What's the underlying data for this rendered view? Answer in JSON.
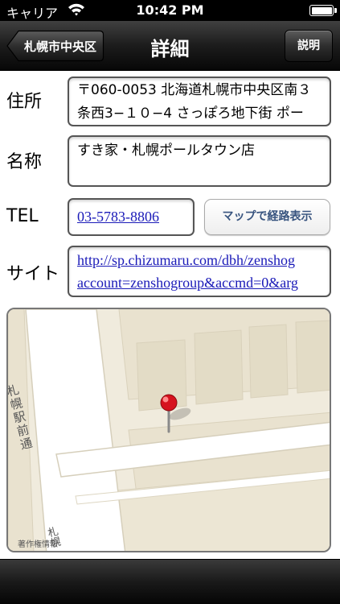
{
  "status_bar": {
    "carrier": "キャリア",
    "time": "10:42 PM",
    "wifi_icon": "wifi-icon",
    "battery_icon": "battery-icon"
  },
  "nav": {
    "back_label": "札幌市中央区",
    "title": "詳細",
    "help_label": "説明"
  },
  "address": {
    "label": "住所",
    "line1": "〒060-0053 北海道札幌市中央区南３",
    "line2": "条西3−１０−4 さっぽろ地下街 ポー"
  },
  "name": {
    "label": "名称",
    "value": "すき家・札幌ポールタウン店"
  },
  "tel": {
    "label": "TEL",
    "value": "03-5783-8806",
    "map_button_label": "マップで経路表示"
  },
  "site": {
    "label": "サイト",
    "line1": "http://sp.chizumaru.com/dbh/zenshog",
    "line2": "account=zenshogroup&accmd=0&arg"
  },
  "map": {
    "street_label": "札幌駅前通",
    "street_label_2": "札幌",
    "copyright": "著作権情報",
    "pin_icon": "map-pin-icon"
  },
  "colors": {
    "link": "#1a1ab8",
    "button_text": "#38547f",
    "map_land": "#f0ebdd",
    "map_block": "#e9e2cf",
    "map_road": "#ffffff",
    "pin": "#d6121e"
  }
}
